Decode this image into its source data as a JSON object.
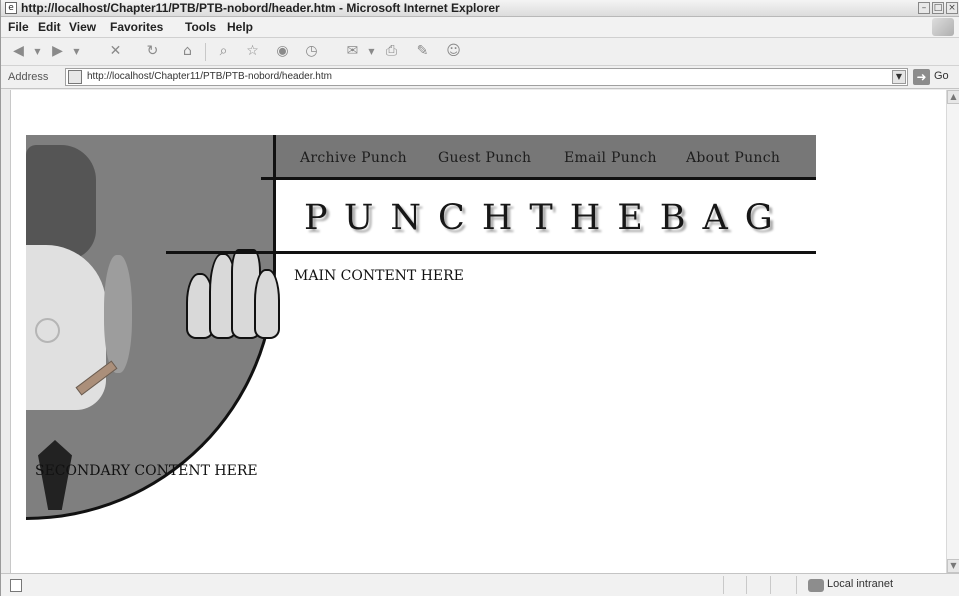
{
  "window": {
    "title": "http://localhost/Chapter11/PTB/PTB-nobord/header.htm - Microsoft Internet Explorer"
  },
  "menu": {
    "items": [
      "File",
      "Edit",
      "View",
      "Favorites",
      "Tools",
      "Help"
    ]
  },
  "address": {
    "label": "Address",
    "url": "http://localhost/Chapter11/PTB/PTB-nobord/header.htm",
    "go_label": "Go"
  },
  "page": {
    "nav_links": [
      "Archive Punch",
      "Guest Punch",
      "Email Punch",
      "About Punch"
    ],
    "brand_text": "PUNCHTHEBAG",
    "main_content": "MAIN CONTENT HERE",
    "secondary_content": "SECONDARY CONTENT HERE"
  },
  "status": {
    "zone": "Local intranet"
  },
  "icons": {
    "back": "back-arrow-icon",
    "forward": "forward-arrow-icon",
    "stop": "stop-icon",
    "refresh": "refresh-icon",
    "home": "home-icon",
    "search": "search-icon",
    "favorites": "star-icon",
    "media": "media-icon",
    "history": "history-icon",
    "mail": "mail-icon",
    "print": "print-icon",
    "edit": "edit-icon",
    "messenger": "messenger-icon"
  },
  "colors": {
    "header_band": "#777777",
    "text": "#111111"
  }
}
